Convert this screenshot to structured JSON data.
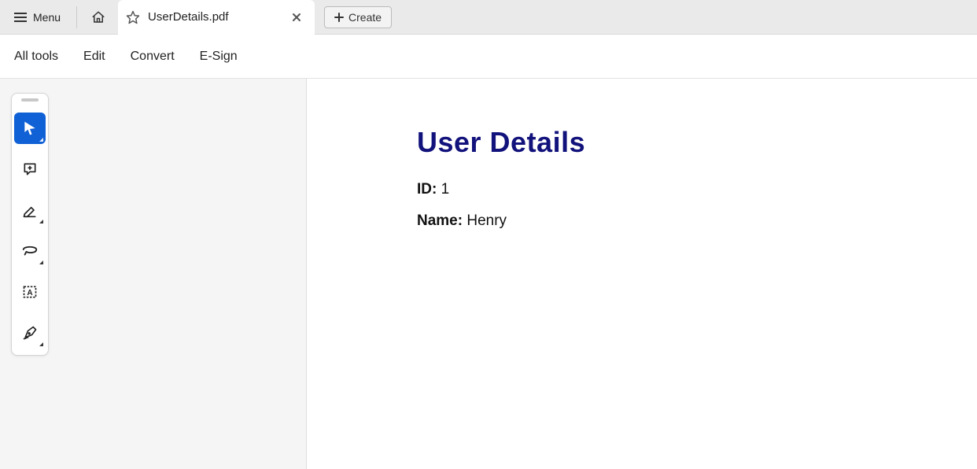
{
  "topbar": {
    "menu_label": "Menu",
    "create_label": "Create"
  },
  "tab": {
    "title": "UserDetails.pdf"
  },
  "menubar": {
    "items": [
      "All tools",
      "Edit",
      "Convert",
      "E-Sign"
    ]
  },
  "tools": {
    "select": "select-tool",
    "comment": "comment-tool",
    "highlight": "highlight-tool",
    "draw": "draw-freeform-tool",
    "textbox": "text-box-tool",
    "sign": "sign-tool"
  },
  "document": {
    "title": "User Details",
    "fields": [
      {
        "label": "ID:",
        "value": "1"
      },
      {
        "label": "Name:",
        "value": "Henry"
      }
    ]
  }
}
